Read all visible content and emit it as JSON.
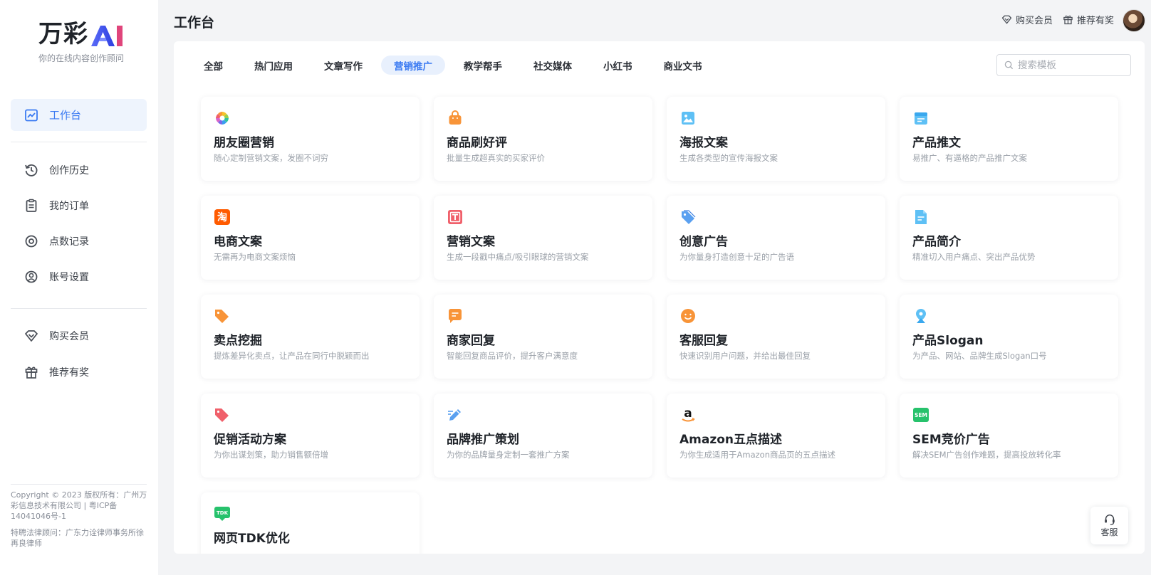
{
  "brand": {
    "name": "万彩",
    "ai": "AI",
    "tagline": "你的在线内容创作顾问"
  },
  "sidebar": {
    "items": [
      {
        "label": "工作台",
        "icon": "dashboard-icon",
        "active": true
      },
      {
        "label": "创作历史",
        "icon": "history-icon"
      },
      {
        "label": "我的订单",
        "icon": "order-icon"
      },
      {
        "label": "点数记录",
        "icon": "points-icon"
      },
      {
        "label": "账号设置",
        "icon": "account-icon"
      },
      {
        "label": "购买会员",
        "icon": "diamond-icon"
      },
      {
        "label": "推荐有奖",
        "icon": "gift-icon"
      }
    ],
    "footer": {
      "copyright": "Copyright © 2023 版权所有：广州万彩信息技术有限公司 | 粤ICP备14041046号-1",
      "legal": "特聘法律顾问：广东力诠律师事务所徐再良律师"
    }
  },
  "header": {
    "title": "工作台",
    "buy_vip": "购买会员",
    "referral": "推荐有奖"
  },
  "tabs": [
    "全部",
    "热门应用",
    "文章写作",
    "营销推广",
    "教学帮手",
    "社交媒体",
    "小红书",
    "商业文书"
  ],
  "active_tab": "营销推广",
  "search": {
    "placeholder": "搜索模板"
  },
  "cards": [
    {
      "title": "朋友圈营销",
      "desc": "随心定制营销文案，发圈不词穷",
      "icon": "color-wheel-icon"
    },
    {
      "title": "商品刷好评",
      "desc": "批量生成超真实的买家评价",
      "icon": "shopping-bag-icon"
    },
    {
      "title": "海报文案",
      "desc": "生成各类型的宣传海报文案",
      "icon": "picture-icon"
    },
    {
      "title": "产品推文",
      "desc": "易推广、有逼格的产品推广文案",
      "icon": "calendar-doc-icon"
    },
    {
      "title": "电商文案",
      "desc": "无需再为电商文案烦恼",
      "icon": "taobao-icon"
    },
    {
      "title": "营销文案",
      "desc": "生成一段戳中痛点/吸引眼球的营销文案",
      "icon": "text-t-icon"
    },
    {
      "title": "创意广告",
      "desc": "为你量身打造创意十足的广告语",
      "icon": "tag-icon"
    },
    {
      "title": "产品简介",
      "desc": "精准切入用户痛点、突出产品优势",
      "icon": "document-icon"
    },
    {
      "title": "卖点挖掘",
      "desc": "提炼差异化卖点，让产品在同行中脱颖而出",
      "icon": "price-tag-icon"
    },
    {
      "title": "商家回复",
      "desc": "智能回复商品评价，提升客户满意度",
      "icon": "chat-icon"
    },
    {
      "title": "客服回复",
      "desc": "快速识别用户问题，并给出最佳回复",
      "icon": "smile-icon"
    },
    {
      "title": "产品Slogan",
      "desc": "为产品、网站、品牌生成Slogan口号",
      "icon": "location-pin-icon"
    },
    {
      "title": "促销活动方案",
      "desc": "为你出谋划策，助力销售额倍增",
      "icon": "promo-tag-icon"
    },
    {
      "title": "品牌推广策划",
      "desc": "为你的品牌量身定制一套推广方案",
      "icon": "pencil-icon"
    },
    {
      "title": "Amazon五点描述",
      "desc": "为你生成适用于Amazon商品页的五点描述",
      "icon": "amazon-icon"
    },
    {
      "title": "SEM竞价广告",
      "desc": "解决SEM广告创作难题，提高投放转化率",
      "icon": "sem-icon"
    },
    {
      "title": "网页TDK优化",
      "desc": "",
      "icon": "tdk-icon"
    }
  ],
  "icon_labels": {
    "taobao": "淘",
    "sem": "SEM",
    "tdk": "TDK",
    "amazon": "a"
  },
  "service": {
    "label": "客服"
  },
  "colors": {
    "accent": "#3a7af2",
    "accent_bg": "#eef4fd",
    "orange": "#f89438",
    "red": "#f0606b",
    "blue": "#5aa0f0",
    "green": "#27c26c"
  }
}
